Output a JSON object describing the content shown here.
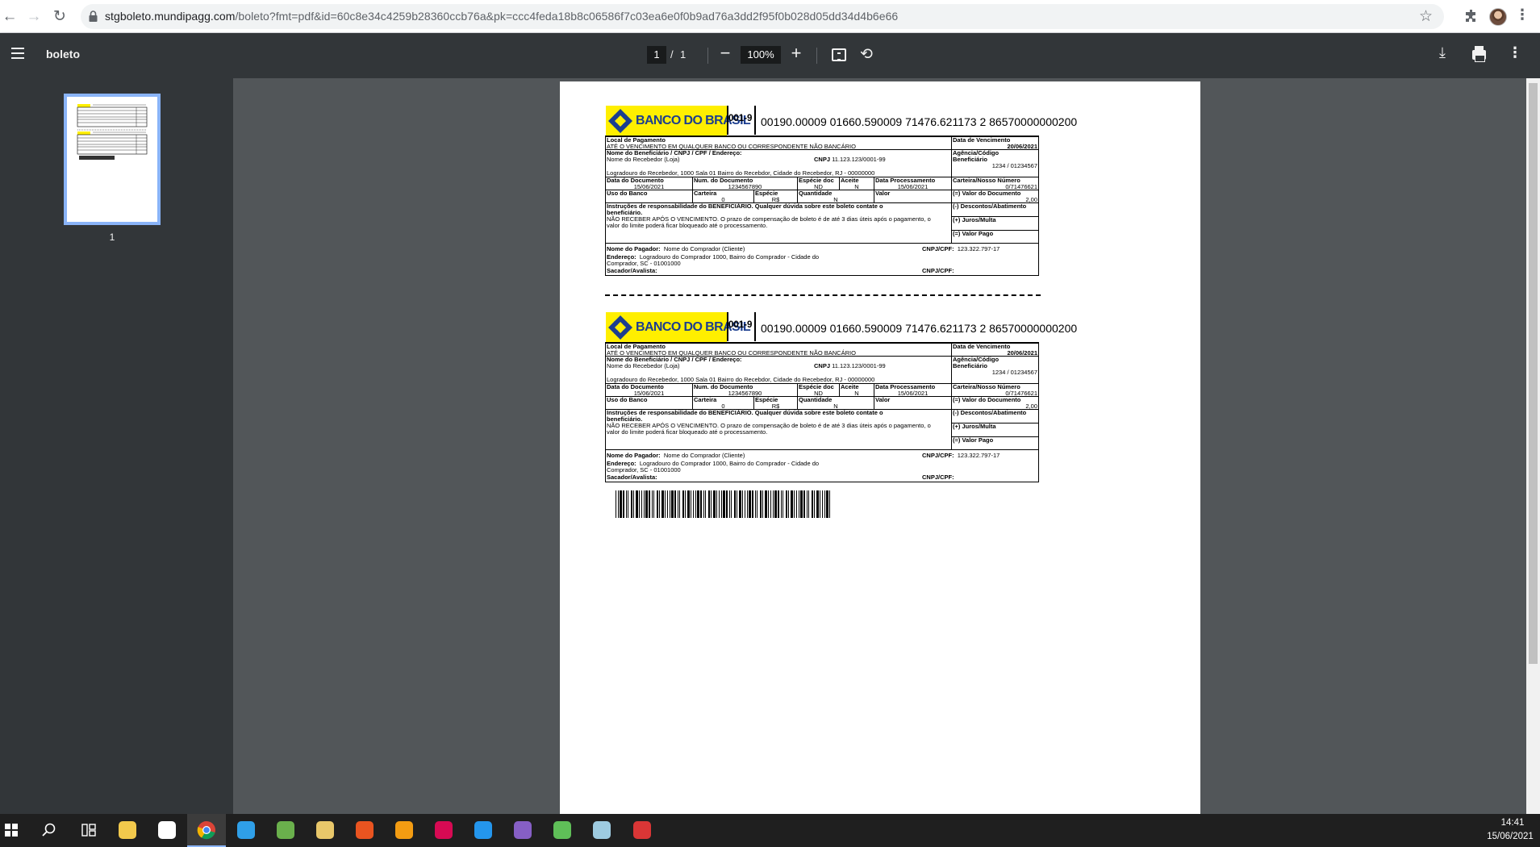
{
  "browser": {
    "url_host": "stgboleto.mundipagg.com",
    "url_path": "/boleto?fmt=pdf&id=60c8e34c4259b28360ccb76a&pk=ccc4feda18b8c06586f7c03ea6e0f0b9ad76a3dd2f95f0b028d05dd34d4b6e66",
    "icons": [
      "back-arrow-icon",
      "forward-arrow-icon",
      "reload-icon",
      "lock-icon",
      "star-icon",
      "extensions-icon",
      "avatar",
      "menu-icon"
    ]
  },
  "toolbar": {
    "title": "boleto",
    "page_current": "1",
    "page_sep": "/",
    "page_total": "1",
    "zoom": "100%",
    "zoom_out": "−",
    "zoom_in": "+"
  },
  "sidebar": {
    "thumbnail_label": "1"
  },
  "boleto": {
    "bank_name": "BANCO DO BRASIL",
    "bank_code": "001-9",
    "digit_line": "00190.00009 01660.590009 71476.621173 2 86570000000200",
    "local_pagamento_label": "Local de Pagamento",
    "local_pagamento": "ATÉ O VENCIMENTO EM QUALQUER BANCO OU CORRESPONDENTE NÃO BANCÁRIO",
    "vencimento_label": "Data de Vencimento",
    "vencimento": "20/06/2021",
    "beneficiario_label": "Nome do Beneficiário / CNPJ / CPF / Endereço:",
    "beneficiario": "Nome do Recebedor (Loja)",
    "cnpj_label": "CNPJ",
    "cnpj": "11.123.123/0001-99",
    "beneficiario_endereco": "Logradouro do Recebedor, 1000 Sala 01 Bairro do Recebdor, Cidade do Recebedor, RJ - 00000000",
    "agencia_label_1": "Agência/Código",
    "agencia_label_2": "Beneficiário",
    "agencia": "1234 / 01234567",
    "data_documento_label": "Data do Documento",
    "data_documento": "15/06/2021",
    "num_documento_label": "Num. do Documento",
    "num_documento": "1234567890",
    "especie_doc_label": "Espécie doc",
    "especie_doc": "ND",
    "aceite_label": "Aceite",
    "aceite": "N",
    "data_processamento_label": "Data Processamento",
    "data_processamento": "15/06/2021",
    "nosso_numero_label": "Carteira/Nosso Número",
    "nosso_numero": "0/71476621",
    "uso_banco_label": "Uso do Banco",
    "carteira_label": "Carteira",
    "carteira": "0",
    "especie_label": "Espécie",
    "especie": "R$",
    "quantidade_label": "Quantidade",
    "quantidade": "N",
    "valor_label": "Valor",
    "valor_documento_label": "(=) Valor do Documento",
    "valor_documento": "2,00",
    "instrucoes_title_1": "Instruções de responsabilidade do BENEFICIÁRIO. Qualquer dúvida sobre este boleto contate o",
    "instrucoes_title_2": "beneficiário.",
    "instrucoes_1": "NÃO RECEBER APÓS O VENCIMENTO. O prazo de compensação de boleto é de até 3 dias úteis após o pagamento, o",
    "instrucoes_2": "valor do limite poderá ficar bloqueado até o processamento.",
    "descontos_label": "(-) Descontos/Abatimento",
    "juros_label": "(+) Juros/Multa",
    "valor_pago_label": "(=) Valor Pago",
    "pagador_label": "Nome do Pagador:",
    "pagador": "Nome do Comprador (Cliente)",
    "pagador_cnpj_label": "CNPJ/CPF:",
    "pagador_cnpj": "123.322.797-17",
    "endereco_label": "Endereço:",
    "endereco_1": "Logradouro do Comprador 1000, Bairro do Comprador - Cidade do",
    "endereco_2": "Comprador, SC - 01001000",
    "sacador_label": "Sacador/Avalista:",
    "sacador_cnpj_label": "CNPJ/CPF:"
  },
  "taskbar": {
    "apps": [
      "windows-start-icon",
      "search-icon",
      "task-view-icon",
      "file-explorer-icon",
      "store-icon",
      "chrome-icon",
      "vscode-icon",
      "app-globe-icon",
      "git-icon",
      "ubuntu-icon",
      "app-orange-icon",
      "debian-icon",
      "docker-icon",
      "visual-studio-icon",
      "app-green-icon",
      "app-notes-icon",
      "app-red-icon"
    ],
    "time": "14:41",
    "date": "15/06/2021"
  }
}
